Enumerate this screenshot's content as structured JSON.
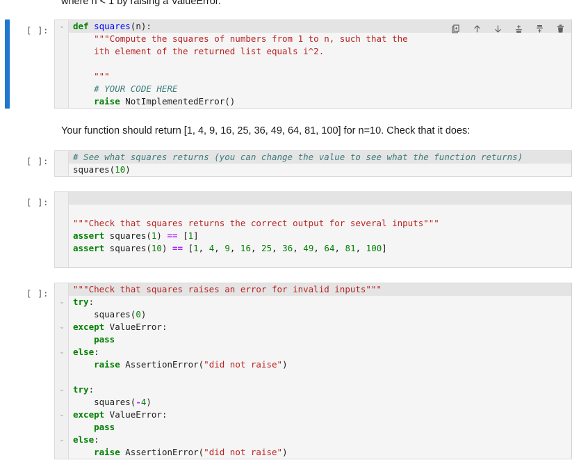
{
  "app": {
    "kind": "jupyter-notebook",
    "accent_color": "#1f77d0",
    "cell_background": "#f5f5f5",
    "highlight_line_background": "#e4e4e4"
  },
  "top_markdown": {
    "text": "where n < 1 by raising a ValueError."
  },
  "toolbar": {
    "buttons": [
      {
        "name": "duplicate-cell",
        "label": "Duplicate this cell"
      },
      {
        "name": "move-cell-up",
        "label": "Move this cell up"
      },
      {
        "name": "move-cell-down",
        "label": "Move this cell down"
      },
      {
        "name": "insert-cell-above",
        "label": "Insert a cell above"
      },
      {
        "name": "insert-cell-below",
        "label": "Insert a cell below"
      },
      {
        "name": "delete-cell",
        "label": "Delete this cell"
      }
    ]
  },
  "cells": [
    {
      "id": "cell-1",
      "type": "code",
      "prompt": "[ ]:",
      "selected": true,
      "toolbar_visible": true,
      "lines": [
        {
          "highlight": true,
          "chevron": true,
          "tokens": [
            {
              "t": "k",
              "v": "def"
            },
            {
              "t": "p",
              "v": " "
            },
            {
              "t": "f",
              "v": "squares"
            },
            {
              "t": "p",
              "v": "(n):"
            }
          ]
        },
        {
          "highlight": false,
          "chevron": false,
          "tokens": [
            {
              "t": "s",
              "v": "    \"\"\"Compute the squares of numbers from 1 to n, such that the"
            }
          ]
        },
        {
          "highlight": false,
          "chevron": false,
          "tokens": [
            {
              "t": "s",
              "v": "    ith element of the returned list equals i^2."
            }
          ]
        },
        {
          "highlight": false,
          "chevron": false,
          "tokens": [
            {
              "t": "s",
              "v": ""
            }
          ]
        },
        {
          "highlight": false,
          "chevron": false,
          "tokens": [
            {
              "t": "s",
              "v": "    \"\"\""
            }
          ]
        },
        {
          "highlight": false,
          "chevron": false,
          "tokens": [
            {
              "t": "c",
              "v": "    # YOUR CODE HERE"
            }
          ]
        },
        {
          "highlight": false,
          "chevron": false,
          "tokens": [
            {
              "t": "p",
              "v": "    "
            },
            {
              "t": "k",
              "v": "raise"
            },
            {
              "t": "p",
              "v": " NotImplementedError()"
            }
          ]
        }
      ]
    },
    {
      "id": "cell-2",
      "type": "markdown",
      "text": "Your function should return [1, 4, 9, 16, 25, 36, 49, 64, 81, 100] for n=10. Check that it does:"
    },
    {
      "id": "cell-3",
      "type": "code",
      "prompt": "[ ]:",
      "selected": false,
      "toolbar_visible": false,
      "lines": [
        {
          "highlight": true,
          "chevron": false,
          "tokens": [
            {
              "t": "c",
              "v": "# See what squares returns (you can change the value to see what the function returns)"
            }
          ]
        },
        {
          "highlight": false,
          "chevron": false,
          "tokens": [
            {
              "t": "p",
              "v": "squares("
            },
            {
              "t": "n",
              "v": "10"
            },
            {
              "t": "p",
              "v": ")"
            }
          ]
        }
      ]
    },
    {
      "id": "cell-4",
      "type": "code",
      "prompt": "[ ]:",
      "selected": false,
      "toolbar_visible": false,
      "lines": [
        {
          "highlight": true,
          "chevron": false,
          "tokens": [
            {
              "t": "p",
              "v": ""
            }
          ]
        },
        {
          "highlight": false,
          "chevron": false,
          "tokens": [
            {
              "t": "p",
              "v": ""
            }
          ]
        },
        {
          "highlight": false,
          "chevron": false,
          "tokens": [
            {
              "t": "s",
              "v": "\"\"\"Check that squares returns the correct output for several inputs\"\"\""
            }
          ]
        },
        {
          "highlight": false,
          "chevron": false,
          "tokens": [
            {
              "t": "k",
              "v": "assert"
            },
            {
              "t": "p",
              "v": " squares("
            },
            {
              "t": "n",
              "v": "1"
            },
            {
              "t": "p",
              "v": ") "
            },
            {
              "t": "o",
              "v": "=="
            },
            {
              "t": "p",
              "v": " ["
            },
            {
              "t": "n",
              "v": "1"
            },
            {
              "t": "p",
              "v": "]"
            }
          ]
        },
        {
          "highlight": false,
          "chevron": false,
          "tokens": [
            {
              "t": "k",
              "v": "assert"
            },
            {
              "t": "p",
              "v": " squares("
            },
            {
              "t": "n",
              "v": "10"
            },
            {
              "t": "p",
              "v": ") "
            },
            {
              "t": "o",
              "v": "=="
            },
            {
              "t": "p",
              "v": " ["
            },
            {
              "t": "n",
              "v": "1"
            },
            {
              "t": "p",
              "v": ", "
            },
            {
              "t": "n",
              "v": "4"
            },
            {
              "t": "p",
              "v": ", "
            },
            {
              "t": "n",
              "v": "9"
            },
            {
              "t": "p",
              "v": ", "
            },
            {
              "t": "n",
              "v": "16"
            },
            {
              "t": "p",
              "v": ", "
            },
            {
              "t": "n",
              "v": "25"
            },
            {
              "t": "p",
              "v": ", "
            },
            {
              "t": "n",
              "v": "36"
            },
            {
              "t": "p",
              "v": ", "
            },
            {
              "t": "n",
              "v": "49"
            },
            {
              "t": "p",
              "v": ", "
            },
            {
              "t": "n",
              "v": "64"
            },
            {
              "t": "p",
              "v": ", "
            },
            {
              "t": "n",
              "v": "81"
            },
            {
              "t": "p",
              "v": ", "
            },
            {
              "t": "n",
              "v": "100"
            },
            {
              "t": "p",
              "v": "]"
            }
          ]
        },
        {
          "highlight": false,
          "chevron": false,
          "tokens": [
            {
              "t": "p",
              "v": ""
            }
          ]
        }
      ]
    },
    {
      "id": "cell-5",
      "type": "code",
      "prompt": "[ ]:",
      "selected": false,
      "toolbar_visible": false,
      "lines": [
        {
          "highlight": true,
          "chevron": false,
          "tokens": [
            {
              "t": "s",
              "v": "\"\"\"Check that squares raises an error for invalid inputs\"\"\""
            }
          ]
        },
        {
          "highlight": false,
          "chevron": true,
          "tokens": [
            {
              "t": "k",
              "v": "try"
            },
            {
              "t": "p",
              "v": ":"
            }
          ]
        },
        {
          "highlight": false,
          "chevron": false,
          "tokens": [
            {
              "t": "p",
              "v": "    squares("
            },
            {
              "t": "n",
              "v": "0"
            },
            {
              "t": "p",
              "v": ")"
            }
          ]
        },
        {
          "highlight": false,
          "chevron": true,
          "tokens": [
            {
              "t": "k",
              "v": "except"
            },
            {
              "t": "p",
              "v": " ValueError:"
            }
          ]
        },
        {
          "highlight": false,
          "chevron": false,
          "tokens": [
            {
              "t": "p",
              "v": "    "
            },
            {
              "t": "k",
              "v": "pass"
            }
          ]
        },
        {
          "highlight": false,
          "chevron": true,
          "tokens": [
            {
              "t": "k",
              "v": "else"
            },
            {
              "t": "p",
              "v": ":"
            }
          ]
        },
        {
          "highlight": false,
          "chevron": false,
          "tokens": [
            {
              "t": "p",
              "v": "    "
            },
            {
              "t": "k",
              "v": "raise"
            },
            {
              "t": "p",
              "v": " AssertionError("
            },
            {
              "t": "s",
              "v": "\"did not raise\""
            },
            {
              "t": "p",
              "v": ")"
            }
          ]
        },
        {
          "highlight": false,
          "chevron": false,
          "tokens": [
            {
              "t": "p",
              "v": ""
            }
          ]
        },
        {
          "highlight": false,
          "chevron": true,
          "tokens": [
            {
              "t": "k",
              "v": "try"
            },
            {
              "t": "p",
              "v": ":"
            }
          ]
        },
        {
          "highlight": false,
          "chevron": false,
          "tokens": [
            {
              "t": "p",
              "v": "    squares("
            },
            {
              "t": "o",
              "v": "-"
            },
            {
              "t": "n",
              "v": "4"
            },
            {
              "t": "p",
              "v": ")"
            }
          ]
        },
        {
          "highlight": false,
          "chevron": true,
          "tokens": [
            {
              "t": "k",
              "v": "except"
            },
            {
              "t": "p",
              "v": " ValueError:"
            }
          ]
        },
        {
          "highlight": false,
          "chevron": false,
          "tokens": [
            {
              "t": "p",
              "v": "    "
            },
            {
              "t": "k",
              "v": "pass"
            }
          ]
        },
        {
          "highlight": false,
          "chevron": true,
          "tokens": [
            {
              "t": "k",
              "v": "else"
            },
            {
              "t": "p",
              "v": ":"
            }
          ]
        },
        {
          "highlight": false,
          "chevron": false,
          "tokens": [
            {
              "t": "p",
              "v": "    "
            },
            {
              "t": "k",
              "v": "raise"
            },
            {
              "t": "p",
              "v": " AssertionError("
            },
            {
              "t": "s",
              "v": "\"did not raise\""
            },
            {
              "t": "p",
              "v": ")"
            }
          ]
        }
      ]
    }
  ]
}
